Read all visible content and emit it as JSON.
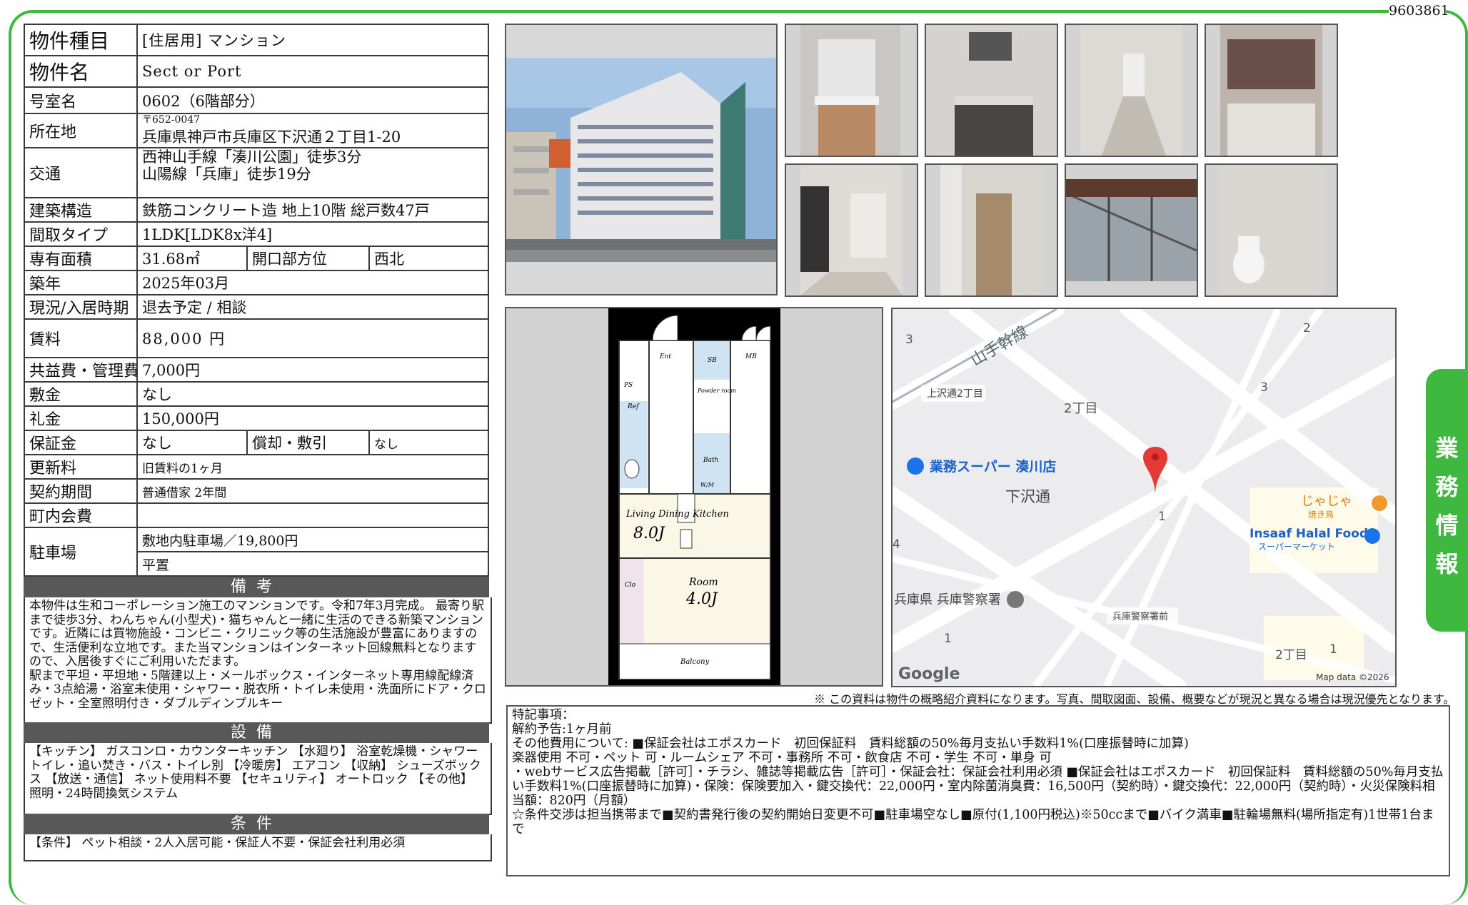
{
  "doc_id": "9603861",
  "specs": {
    "type_label": "物件種目",
    "type_value": "[住居用] マンション",
    "name_label": "物件名",
    "name_value": "Sect or Port",
    "room_label": "号室名",
    "room_value": "0602（6階部分）",
    "addr_label": "所在地",
    "addr_zip": "〒652-0047",
    "addr_value": "兵庫県神戸市兵庫区下沢通２丁目1-20",
    "access_label": "交通",
    "access_line1": "西神山手線「湊川公園」徒歩3分",
    "access_line2": "山陽線「兵庫」徒歩19分",
    "structure_label": "建築構造",
    "structure_value": "鉄筋コンクリート造 地上10階 総戸数47戸",
    "layout_label": "間取タイプ",
    "layout_value": "1LDK[LDK8x洋4]",
    "area_label": "専有面積",
    "area_value": "31.68㎡",
    "facing_label": "開口部方位",
    "facing_value": "西北",
    "built_label": "築年",
    "built_value": "2025年03月",
    "status_label": "現況/入居時期",
    "status_value": "退去予定 / 相談",
    "rent_label": "賃料",
    "rent_value": "88,000 円",
    "fee_label": "共益費・管理費",
    "fee_value": "7,000円",
    "deposit_label": "敷金",
    "deposit_value": "なし",
    "keymoney_label": "礼金",
    "keymoney_value": "150,000円",
    "guarantee_label": "保証金",
    "guarantee_value": "なし",
    "amort_label": "償却・敷引",
    "amort_value": "なし",
    "renew_label": "更新料",
    "renew_value": "旧賃料の1ヶ月",
    "contract_label": "契約期間",
    "contract_value": "普通借家 2年間",
    "assoc_label": "町内会費",
    "assoc_value": "",
    "parking_label": "駐車場",
    "parking_line1": "敷地内駐車場／19,800円",
    "parking_line2": "平置"
  },
  "remarks": {
    "header": "備考",
    "text": "本物件は生和コーポレーション施工のマンションです。令和7年3月完成。 最寄り駅まで徒歩3分、わんちゃん(小型犬)・猫ちゃんと一緒に生活のできる新築マンションです。近隣には買物施設・コンビニ・クリニック等の生活施設が豊富にありますので、生活便利な立地です。また当マンションはインターネット回線無料となりますので、入居後すぐにご利用いただます。\n駅まで平坦・平坦地・5階建以上・メールボックス・インターネット専用線配線済み・3点給湯・浴室未使用・シャワー・脱衣所・トイレ未使用・洗面所にドア・クロゼット・全室照明付き・ダブルディンプルキー"
  },
  "equipment": {
    "header": "設備",
    "text": "【キッチン】 ガスコンロ・カウンターキッチン 【水廻り】 浴室乾燥機・シャワートイレ・追い焚き・バス・トイレ別 【冷暖房】 エアコン 【収納】 シューズボックス 【放送・通信】 ネット使用料不要 【セキュリティ】 オートロック 【その他】 照明・24時間換気システム"
  },
  "conditions": {
    "header": "条件",
    "text": "【条件】 ペット相談・2人入居可能・保証人不要・保証会社利用必須"
  },
  "floorplan": {
    "ent": "Ent",
    "sb": "SB",
    "mb": "MB",
    "ps": "PS",
    "ref": "Ref",
    "powder": "Powder room",
    "bath": "Bath",
    "wm": "W/M",
    "ldk_name": "Living Dining Kitchen",
    "ldk_size": "8.0J",
    "room_name": "Room",
    "room_size": "4.0J",
    "clo": "Clo",
    "balcony": "Balcony"
  },
  "map": {
    "rail": "山手幹線",
    "station1": "上沢通2丁目",
    "block1": "2丁目",
    "store1": "業務スーパー 湊川店",
    "street": "下沢通",
    "restaurant1": "じゃじゃ",
    "restaurant1_sub": "焼き鳥",
    "store2": "Insaaf Halal Food",
    "store2_sub": "スーパーマーケット",
    "police": "兵庫県 兵庫警察署",
    "station2": "兵庫警察署前",
    "block2": "2丁目",
    "n3a": "3",
    "n2": "2",
    "n3b": "3",
    "n4": "4",
    "n1a": "1",
    "n1b": "1",
    "n1c": "1",
    "logo": "Google",
    "credit": "Map data ©2026"
  },
  "disclaimer": "※ この資料は物件の概略紹介資料になります。写真、間取図面、設備、概要などが現況と異なる場合は現況優先となります。",
  "special": "特記事項：\n解約予告:1ヶ月前\nその他費用について: ■保証会社はエポスカード　初回保証料　賃料総額の50%毎月支払い手数料1%(口座振替時に加算)\n楽器使用 不可・ペット 可・ルームシェア 不可・事務所 不可・飲食店 不可・学生 不可・単身 可\n・webサービス広告掲載［許可］・チラシ、雑誌等掲載広告［許可］・保証会社：保証会社利用必須 ■保証会社はエポスカード　初回保証料　賃料総額の50%毎月支払い手数料1%(口座振替時に加算)・保険：保険要加入・鍵交換代：22,000円・室内除菌消臭費：16,500円（契約時）・鍵交換代：22,000円（契約時）・火災保険料相当額：820円（月額）\n☆条件交渉は担当携帯まで■契約書発行後の契約開始日変更不可■駐車場空なし■原付(1,100円税込)※50ccまで■バイク満車■駐輪場無料(場所指定有)1世帯1台まで",
  "side_tab": "業務情報"
}
